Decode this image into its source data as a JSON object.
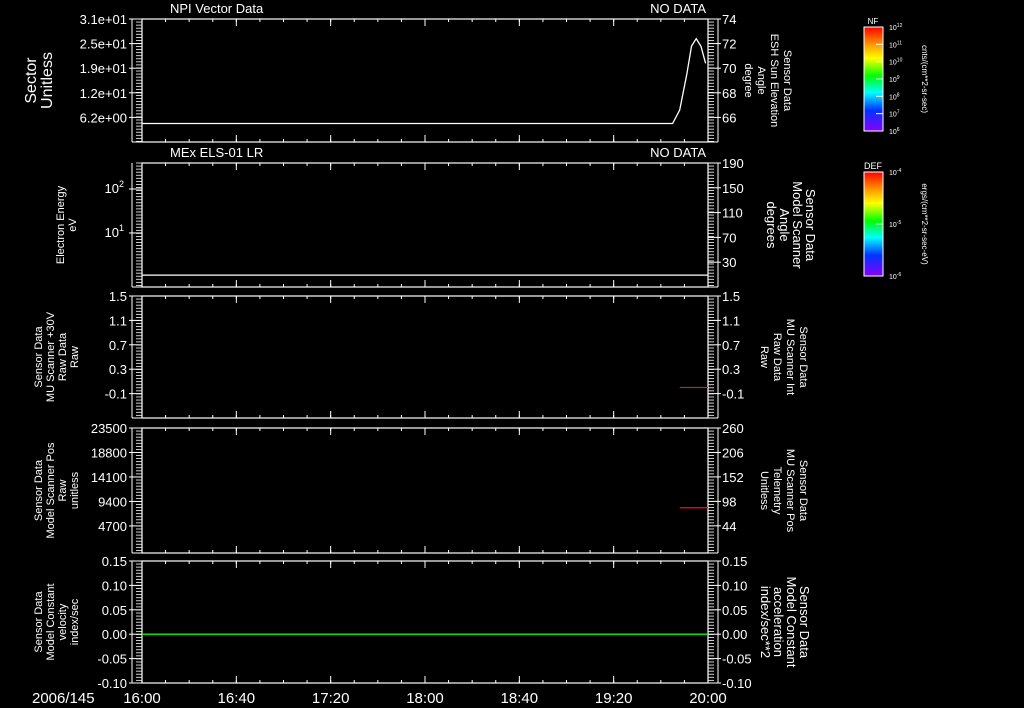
{
  "date_label": "2006/145",
  "x_ticks": [
    "16:00",
    "16:40",
    "17:20",
    "18:00",
    "18:40",
    "19:20",
    "20:00"
  ],
  "chart_data": [
    {
      "type": "line",
      "title": "NPI Vector Data",
      "status": "NO DATA",
      "ylabel_left": [
        "Sector",
        "Unitless"
      ],
      "ylabel_left_color": "#ffffff",
      "ylabel_right": [
        "Sensor Data",
        "ESH Sun Elevation",
        "Angle",
        "degree"
      ],
      "ylabel_right_color": "#ffffff",
      "left_ticks": [
        "3.1e+01",
        "2.5e+01",
        "1.9e+01",
        "1.2e+01",
        "6.2e+00"
      ],
      "left_tick_values": [
        31,
        24.8,
        18.6,
        12.4,
        6.2
      ],
      "ylim_left": [
        0,
        31
      ],
      "right_ticks": [
        "74",
        "72",
        "70",
        "68",
        "66"
      ],
      "right_tick_values": [
        74,
        72,
        70,
        68,
        66
      ],
      "ylim_right": [
        64,
        74
      ],
      "series": [
        {
          "axis": "right",
          "color": "#ffffff",
          "x": [
            "16:00",
            "19:45",
            "19:48",
            "19:51",
            "19:53",
            "19:55",
            "19:57",
            "19:59"
          ],
          "y": [
            65.5,
            65.5,
            66.6,
            69.5,
            71.8,
            72.4,
            71.8,
            70.4
          ]
        }
      ]
    },
    {
      "type": "line",
      "title": "MEx ELS-01 LR",
      "status": "NO DATA",
      "ylabel_left": [
        "Electron Energy",
        "eV"
      ],
      "ylabel_left_color": "#ffffff",
      "ylabel_right": [
        "Sensor Data",
        "Model Scanner",
        "Angle",
        "degrees"
      ],
      "ylabel_right_color": "#ffffff",
      "left_log": true,
      "left_ticks": [
        "10",
        "10"
      ],
      "left_tick_exponents": [
        "2",
        "1"
      ],
      "left_tick_values": [
        100,
        10
      ],
      "ylim_left": [
        0.59,
        390
      ],
      "right_ticks": [
        "190",
        "150",
        "110",
        "70",
        "30"
      ],
      "right_tick_values": [
        190,
        150,
        110,
        70,
        30
      ],
      "ylim_right": [
        -10,
        190
      ],
      "series": [
        {
          "axis": "left",
          "color": "#ffffff",
          "x": [
            "16:00",
            "20:00"
          ],
          "y": [
            1.1,
            1.1
          ]
        }
      ]
    },
    {
      "type": "line",
      "title": "",
      "status": "",
      "ylabel_left": [
        "Sensor Data",
        "MU Scanner +30V",
        "Raw Data",
        "Raw"
      ],
      "ylabel_left_color": "#ffffff",
      "ylabel_right": [
        "Sensor Data",
        "MU Scanner Int",
        "Raw Data",
        "Raw"
      ],
      "ylabel_right_color": "#ff0000",
      "left_ticks": [
        "1.5",
        "1.1",
        "0.7",
        "0.3",
        "-0.1"
      ],
      "left_tick_values": [
        1.5,
        1.1,
        0.7,
        0.3,
        -0.1
      ],
      "ylim_left": [
        -0.5,
        1.5
      ],
      "right_ticks": [
        "1.5",
        "1.1",
        "0.7",
        "0.3",
        "-0.1"
      ],
      "right_tick_values": [
        1.5,
        1.1,
        0.7,
        0.3,
        -0.1
      ],
      "ylim_right": [
        -0.5,
        1.5
      ],
      "series": [
        {
          "axis": "right",
          "color": "#8a3a3a",
          "x": [
            "19:48",
            "20:00"
          ],
          "y": [
            0.0,
            0.0
          ]
        }
      ]
    },
    {
      "type": "line",
      "title": "",
      "status": "",
      "ylabel_left": [
        "Sensor Data",
        "Model Scanner Pos",
        "Raw",
        "unitless"
      ],
      "ylabel_left_color": "#ffffff",
      "ylabel_right": [
        "Sensor Data",
        "MU Scanner Pos",
        "Telemetry",
        "Unitless"
      ],
      "ylabel_right_color": "#ff0000",
      "left_ticks": [
        "23500",
        "18800",
        "14100",
        "9400",
        "4700"
      ],
      "left_tick_values": [
        23500,
        18800,
        14100,
        9400,
        4700
      ],
      "ylim_left": [
        -500,
        23500
      ],
      "right_ticks": [
        "260",
        "206",
        "152",
        "98",
        "44"
      ],
      "right_tick_values": [
        260,
        206,
        152,
        98,
        44
      ],
      "ylim_right": [
        -16,
        260
      ],
      "series": [
        {
          "axis": "right",
          "color": "#ff0000",
          "x": [
            "19:48",
            "20:00"
          ],
          "y": [
            84,
            84
          ]
        }
      ]
    },
    {
      "type": "line",
      "title": "",
      "status": "",
      "ylabel_left": [
        "Sensor Data",
        "Model Constant",
        "velocity",
        "index/sec"
      ],
      "ylabel_left_color": "#ffffff",
      "ylabel_right": [
        "Sensor Data",
        "Model Constant",
        "acceleration",
        "index/sec**2"
      ],
      "ylabel_right_color": "#00ff00",
      "left_ticks": [
        "0.15",
        "0.10",
        "0.05",
        "0.00",
        "-0.05",
        "-0.10"
      ],
      "left_tick_values": [
        0.15,
        0.1,
        0.05,
        0.0,
        -0.05,
        -0.1
      ],
      "ylim_left": [
        -0.1,
        0.15
      ],
      "right_ticks": [
        "0.15",
        "0.10",
        "0.05",
        "0.00",
        "-0.05",
        "-0.10"
      ],
      "right_tick_values": [
        0.15,
        0.1,
        0.05,
        0.0,
        -0.05,
        -0.1
      ],
      "ylim_right": [
        -0.1,
        0.15
      ],
      "series": [
        {
          "axis": "left",
          "color": "#00ff00",
          "x": [
            "16:00",
            "20:00"
          ],
          "y": [
            0,
            0
          ]
        }
      ]
    }
  ],
  "colorbars": [
    {
      "label": "NF",
      "units": "cnts/(cm**2-sr-sec)",
      "ticks": [
        "10",
        "10",
        "10",
        "10",
        "10",
        "10",
        "10"
      ],
      "exponents": [
        "12",
        "11",
        "10",
        "9",
        "8",
        "7",
        "6"
      ]
    },
    {
      "label": "DEF",
      "units": "ergs/(cm**2-sr-sec-eV)",
      "ticks": [
        "10",
        "10",
        "10"
      ],
      "exponents": [
        "-4",
        "-5",
        "-6"
      ]
    }
  ]
}
